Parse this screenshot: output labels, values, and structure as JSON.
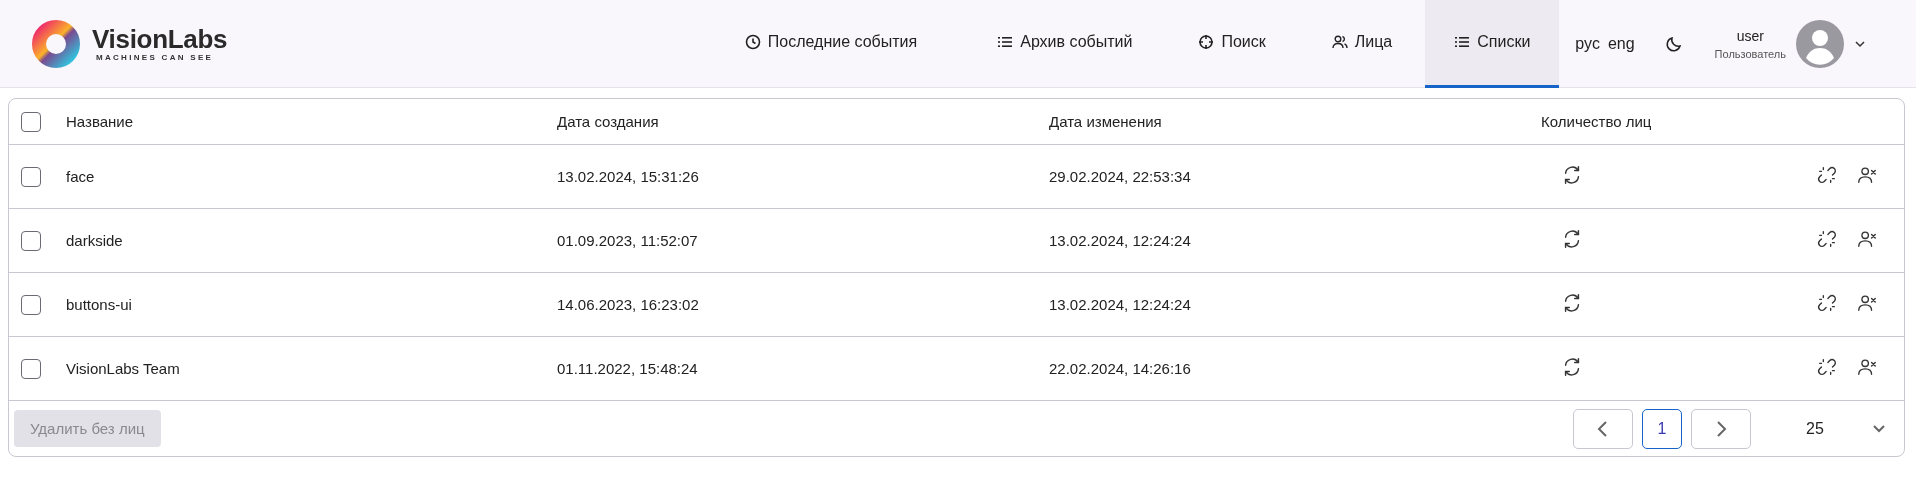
{
  "logo": {
    "name": "VisionLabs",
    "tagline": "MACHINES CAN SEE"
  },
  "nav": [
    {
      "label": "Последние события",
      "kind": "clock",
      "selected": false
    },
    {
      "label": "Архив событий",
      "kind": "list",
      "selected": false
    },
    {
      "label": "Поиск",
      "kind": "target",
      "selected": false
    },
    {
      "label": "Лица",
      "kind": "users",
      "selected": false
    },
    {
      "label": "Списки",
      "kind": "list",
      "selected": true
    }
  ],
  "languages": [
    "рус",
    "eng"
  ],
  "user": {
    "name": "user",
    "role": "Пользователь"
  },
  "table": {
    "select_all_checked": false,
    "columns": [
      "Название",
      "Дата создания",
      "Дата изменения",
      "Количество лиц"
    ],
    "rows": [
      {
        "checked": false,
        "name": "face",
        "created": "13.02.2024, 15:31:26",
        "modified": "29.02.2024, 22:53:34"
      },
      {
        "checked": false,
        "name": "darkside",
        "created": "01.09.2023, 11:52:07",
        "modified": "13.02.2024, 12:24:24"
      },
      {
        "checked": false,
        "name": "buttons-ui",
        "created": "14.06.2023, 16:23:02",
        "modified": "13.02.2024, 12:24:24"
      },
      {
        "checked": false,
        "name": "VisionLabs Team",
        "created": "01.11.2022, 15:48:24",
        "modified": "22.02.2024, 14:26:16"
      }
    ]
  },
  "footer": {
    "delete_button": {
      "label": "Удалить без лиц",
      "disabled": true
    },
    "pages": [
      {
        "label": "1",
        "selected": true
      }
    ],
    "page_size": "25"
  }
}
